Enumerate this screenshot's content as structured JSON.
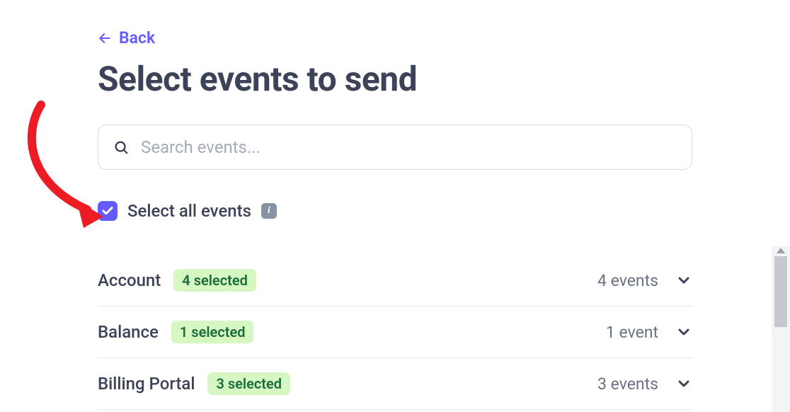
{
  "back": {
    "label": "Back"
  },
  "page": {
    "title": "Select events to send"
  },
  "search": {
    "placeholder": "Search events..."
  },
  "select_all": {
    "label": "Select all events",
    "checked": true
  },
  "categories": [
    {
      "name": "Account",
      "selected_badge": "4 selected",
      "event_count": "4 events"
    },
    {
      "name": "Balance",
      "selected_badge": "1 selected",
      "event_count": "1 event"
    },
    {
      "name": "Billing Portal",
      "selected_badge": "3 selected",
      "event_count": "3 events"
    }
  ],
  "colors": {
    "accent": "#635bff",
    "badge_bg": "#d7f7c2",
    "badge_text": "#1c6b3c",
    "annotation_arrow": "#ed1c24"
  }
}
